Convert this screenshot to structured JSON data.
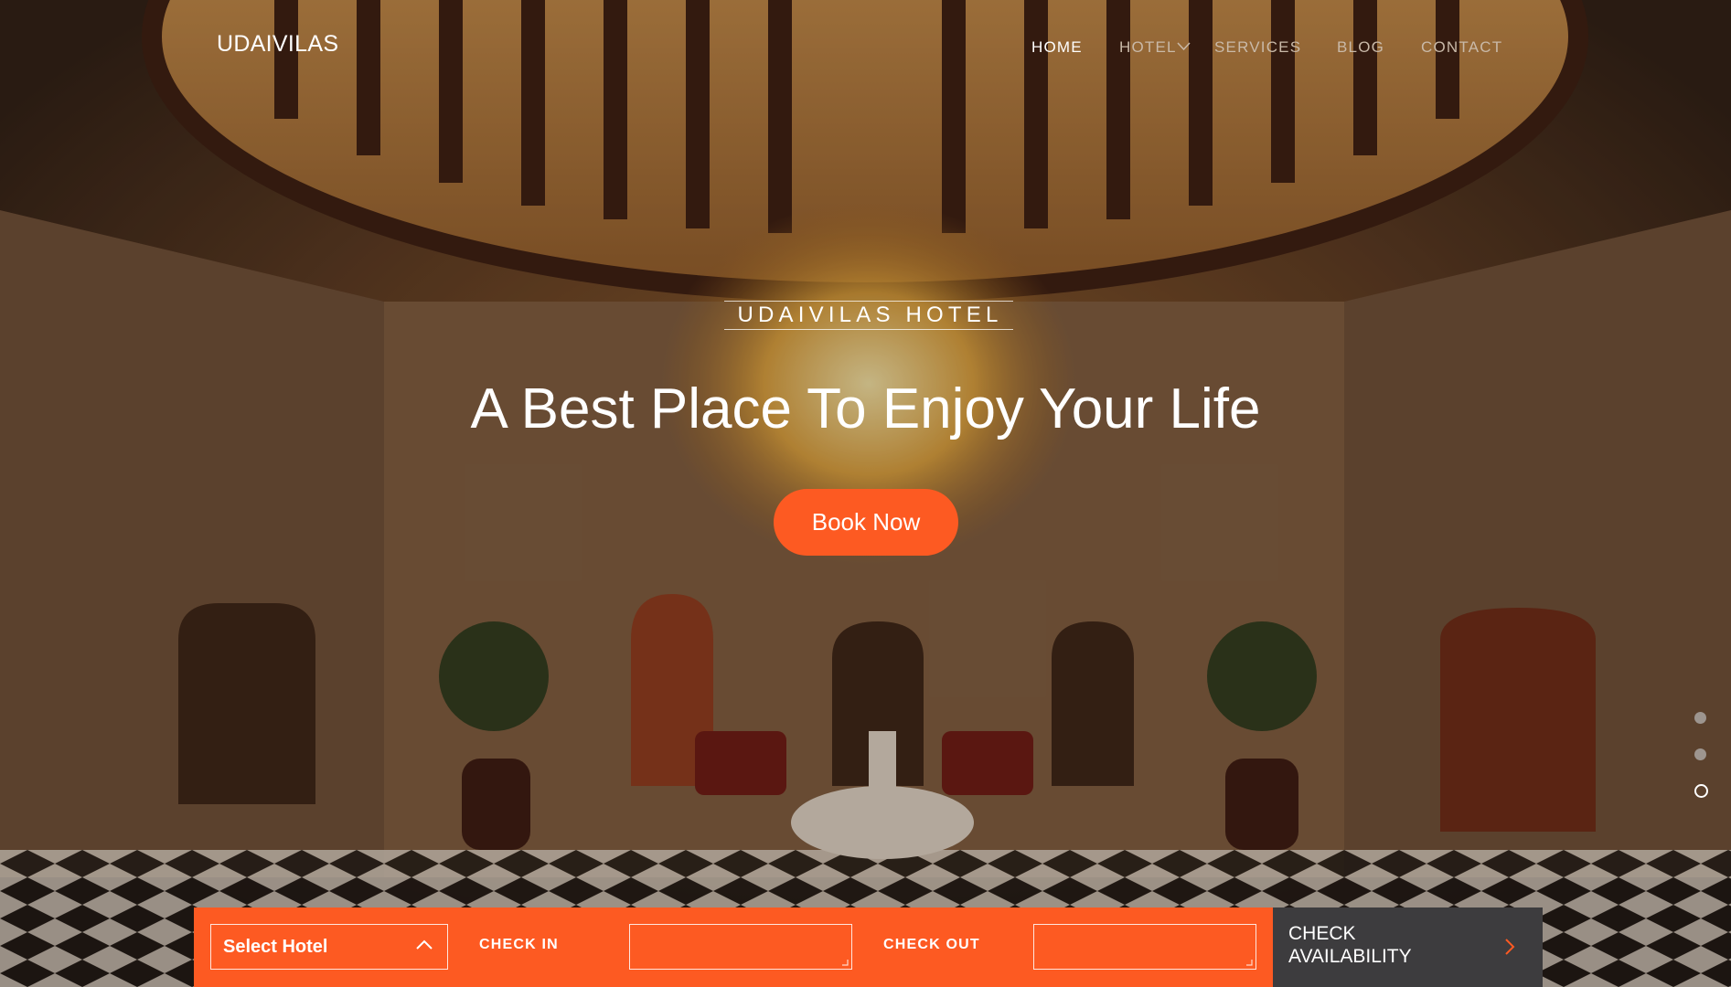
{
  "brand": {
    "name": "UDAIVILAS"
  },
  "nav": {
    "items": [
      {
        "label": "HOME",
        "active": true
      },
      {
        "label": "HOTEL",
        "has_dropdown": true
      },
      {
        "label": "SERVICES"
      },
      {
        "label": "BLOG"
      },
      {
        "label": "CONTACT"
      }
    ],
    "dropdown_icon": "chevron-down-icon"
  },
  "hero": {
    "tagline": "UDAIVILAS HOTEL",
    "headline": "A Best Place To Enjoy Your Life",
    "cta_label": "Book Now"
  },
  "slider": {
    "dot_count": 3,
    "active_index": 2
  },
  "booking": {
    "select_hotel_value": "Select Hotel",
    "select_icon": "chevron-up-icon",
    "check_in_label": "CHECK IN",
    "check_in_value": "",
    "check_out_label": "CHECK OUT",
    "check_out_value": "",
    "submit_label_line1": "CHECK",
    "submit_label_line2": "AVAILABILITY",
    "submit_icon": "chevron-right-icon"
  },
  "colors": {
    "accent": "#fd5a22",
    "submit_bg": "#3d3c3e",
    "nav_inactive": "#c9b9a8",
    "nav_active": "#ffffff"
  }
}
